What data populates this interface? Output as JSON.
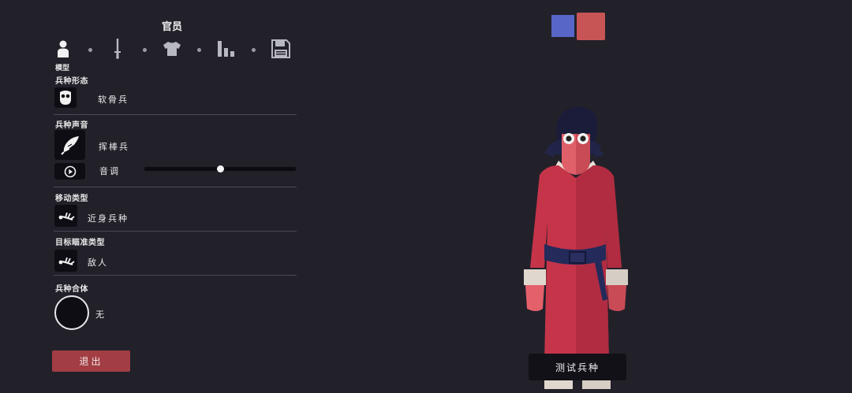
{
  "header": {
    "title": "官员"
  },
  "tabs": [
    {
      "icon": "person-icon",
      "label": "模型",
      "active": true
    },
    {
      "icon": "sword-icon"
    },
    {
      "icon": "shirt-icon"
    },
    {
      "icon": "stats-icon"
    },
    {
      "icon": "save-icon"
    }
  ],
  "sections": {
    "form": {
      "label": "兵种形态",
      "value": "软骨兵",
      "icon": "face-mask-icon"
    },
    "voice": {
      "label": "兵种声音",
      "value": "挥棒兵",
      "icon": "feather-quill-icon",
      "pitch_label": "音调",
      "pitch_level": 0.5,
      "play_icon": "play-icon"
    },
    "movement": {
      "label": "移动类型",
      "value": "近身兵种",
      "icon": "fallen-unit-icon"
    },
    "targeting": {
      "label": "目标瞄准类型",
      "value": "敌人",
      "icon": "fallen-unit-icon"
    },
    "merge": {
      "label": "兵种合体",
      "value": "无",
      "icon": "empty-circle-icon"
    }
  },
  "buttons": {
    "exit": "退出",
    "test_unit": "测试兵种"
  },
  "team_colors": [
    {
      "name": "blue",
      "color": "#5866c8"
    },
    {
      "name": "red",
      "color": "#c85555"
    }
  ],
  "colors": {
    "background": "#22212a",
    "accent_red": "#a23d44"
  }
}
